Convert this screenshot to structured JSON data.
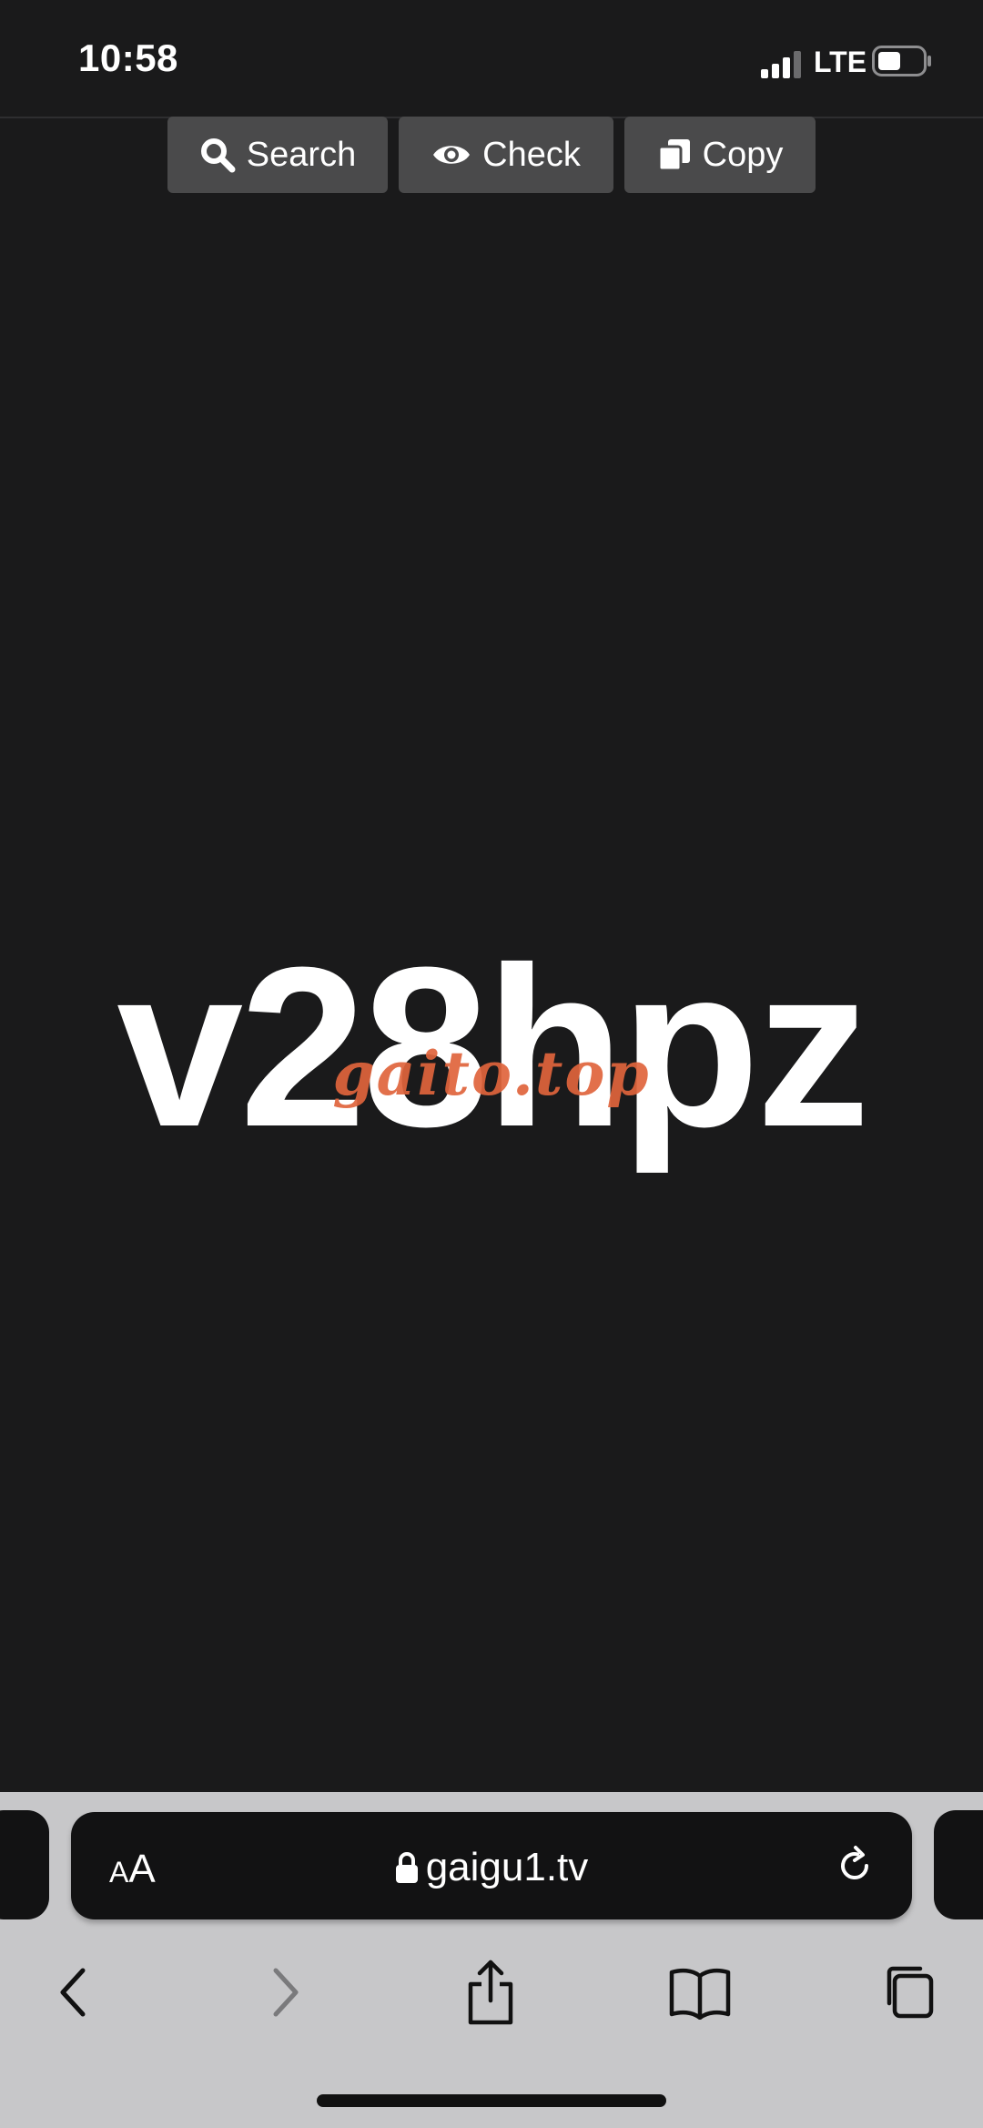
{
  "status_bar": {
    "time": "10:58",
    "network": "LTE"
  },
  "toolbar": {
    "search_label": "Search",
    "check_label": "Check",
    "copy_label": "Copy"
  },
  "content": {
    "code": "v28hpz",
    "watermark": "gaito.top"
  },
  "browser": {
    "text_size_small": "A",
    "text_size_large": "A",
    "url": "gaigu1.tv"
  },
  "icons": [
    "signal-icon",
    "battery-icon",
    "search-icon",
    "eye-icon",
    "copy-icon",
    "lock-icon",
    "reload-icon",
    "back-icon",
    "forward-icon",
    "share-icon",
    "bookmarks-icon",
    "tabs-icon"
  ],
  "colors": {
    "background": "#1a1a1b",
    "button": "#4a4a4b",
    "watermark": "#e0643c",
    "browser_bar": "#c7c7c9"
  }
}
